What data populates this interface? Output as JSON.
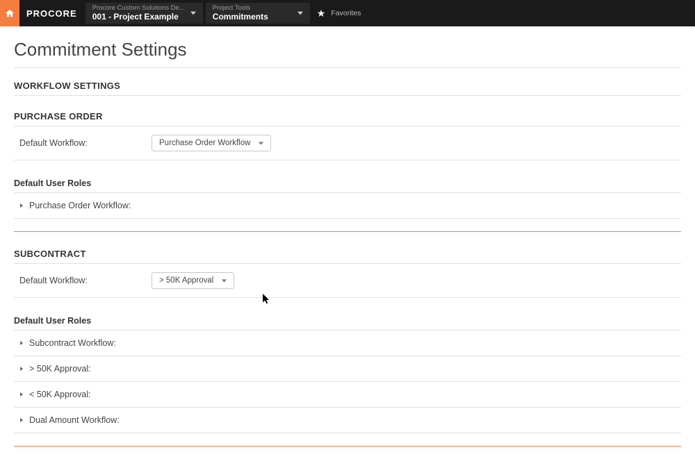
{
  "header": {
    "logo_text": "PROCORE",
    "project_dropdown": {
      "label": "Procore Custom Solutions De...",
      "value": "001 - Project Example"
    },
    "tools_dropdown": {
      "label": "Project Tools",
      "value": "Commitments"
    },
    "favorites_label": "Favorites"
  },
  "page": {
    "title": "Commitment Settings",
    "workflow_settings_heading": "WORKFLOW SETTINGS"
  },
  "purchase_order": {
    "heading": "PURCHASE ORDER",
    "default_workflow_label": "Default Workflow:",
    "default_workflow_value": "Purchase Order Workflow",
    "default_user_roles_heading": "Default User Roles",
    "rows": [
      {
        "label": "Purchase Order Workflow:"
      }
    ]
  },
  "subcontract": {
    "heading": "SUBCONTRACT",
    "default_workflow_label": "Default Workflow:",
    "default_workflow_value": "> 50K Approval",
    "default_user_roles_heading": "Default User Roles",
    "rows": [
      {
        "label": "Subcontract Workflow:"
      },
      {
        "label": "> 50K Approval:"
      },
      {
        "label": "< 50K Approval:"
      },
      {
        "label": "Dual Amount Workflow:"
      }
    ]
  }
}
